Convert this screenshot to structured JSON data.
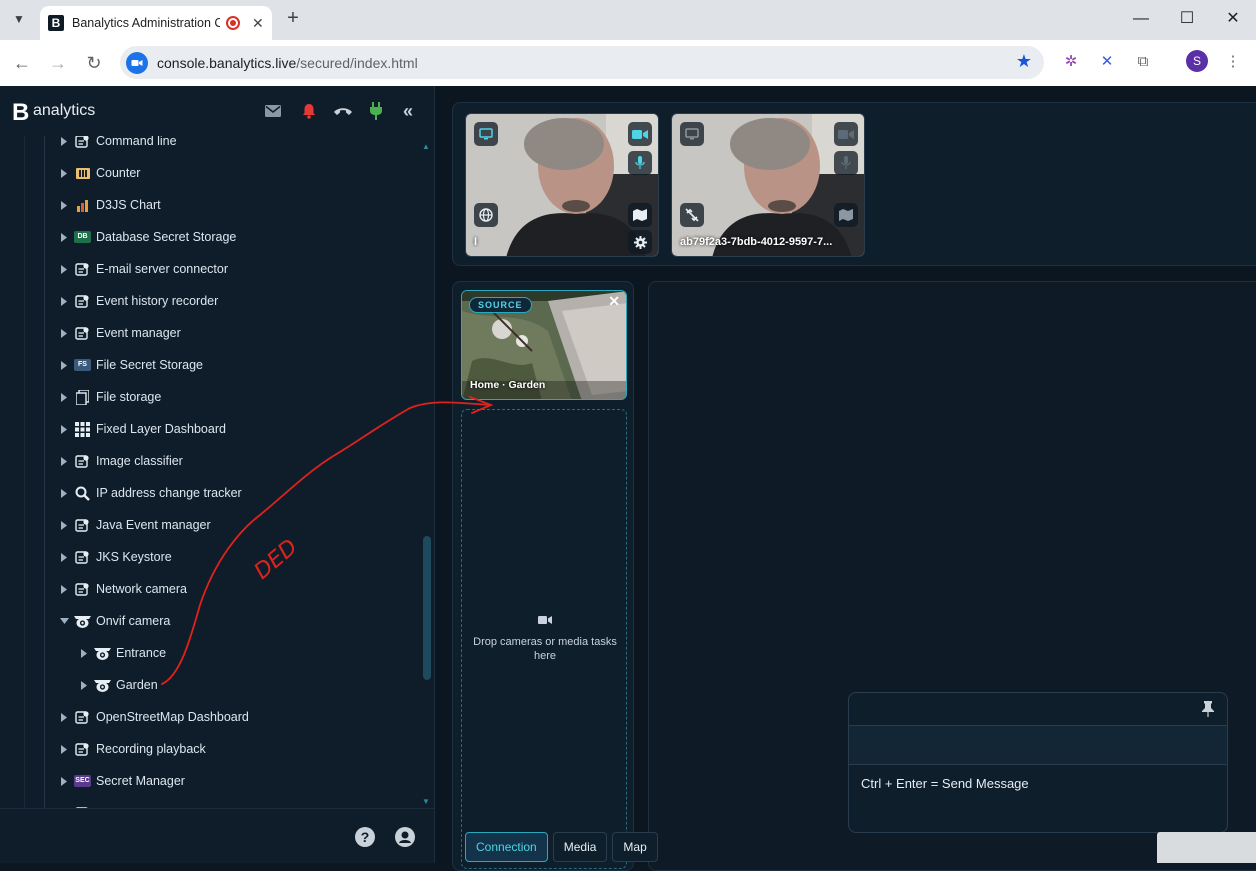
{
  "browser": {
    "tab_title": "Banalytics Administration C",
    "tab_favicon_letter": "B",
    "new_tab": "+",
    "url_host": "console.banalytics.live",
    "url_path": "/secured/index.html",
    "profile_initial": "S",
    "window_controls": [
      "minimize",
      "maximize",
      "close"
    ]
  },
  "app": {
    "logo_letter": "B",
    "logo_text": "analytics",
    "header_icons": [
      "mail-icon",
      "bell-icon",
      "phone-icon",
      "plug-icon",
      "collapse-icon"
    ],
    "tree": [
      {
        "label": "Command line",
        "icon": "command-icon",
        "expanded": false,
        "level": 1
      },
      {
        "label": "Counter",
        "icon": "counter-icon",
        "expanded": false,
        "level": 1
      },
      {
        "label": "D3JS Chart",
        "icon": "chart-icon",
        "expanded": false,
        "level": 1
      },
      {
        "label": "Database Secret Storage",
        "icon": "db-icon",
        "expanded": false,
        "level": 1
      },
      {
        "label": "E-mail server connector",
        "icon": "email-server-icon",
        "expanded": false,
        "level": 1
      },
      {
        "label": "Event history recorder",
        "icon": "recorder-icon",
        "expanded": false,
        "level": 1
      },
      {
        "label": "Event manager",
        "icon": "event-icon",
        "expanded": false,
        "level": 1
      },
      {
        "label": "File Secret Storage",
        "icon": "fs-icon",
        "expanded": false,
        "level": 1
      },
      {
        "label": "File storage",
        "icon": "file-storage-icon",
        "expanded": false,
        "level": 1
      },
      {
        "label": "Fixed Layer Dashboard",
        "icon": "grid-icon",
        "expanded": false,
        "level": 1
      },
      {
        "label": "Image classifier",
        "icon": "classifier-icon",
        "expanded": false,
        "level": 1
      },
      {
        "label": "IP address change tracker",
        "icon": "magnifier-icon",
        "expanded": false,
        "level": 1
      },
      {
        "label": "Java Event manager",
        "icon": "java-icon",
        "expanded": false,
        "level": 1
      },
      {
        "label": "JKS Keystore",
        "icon": "keystore-icon",
        "expanded": false,
        "level": 1
      },
      {
        "label": "Network camera",
        "icon": "network-camera-icon",
        "expanded": false,
        "level": 1
      },
      {
        "label": "Onvif camera",
        "icon": "onvif-camera-icon",
        "expanded": true,
        "level": 1
      },
      {
        "label": "Entrance",
        "icon": "onvif-camera-icon",
        "expanded": false,
        "level": 2
      },
      {
        "label": "Garden",
        "icon": "onvif-camera-icon",
        "expanded": false,
        "level": 2
      },
      {
        "label": "OpenStreetMap Dashboard",
        "icon": "map-dashboard-icon",
        "expanded": false,
        "level": 1
      },
      {
        "label": "Recording playback",
        "icon": "playback-icon",
        "expanded": false,
        "level": 1
      },
      {
        "label": "Secret Manager",
        "icon": "sec-icon",
        "expanded": false,
        "level": 1
      },
      {
        "label": "",
        "icon": "server-icon",
        "expanded": false,
        "level": 1
      }
    ],
    "badges": {
      "db": "DB",
      "fs": "FS",
      "sec": "SEC"
    },
    "footer": {
      "help": "?",
      "user": "user"
    },
    "video_tiles": [
      {
        "name": "I"
      },
      {
        "name": "ab79f2a3-7bdb-4012-9597-7..."
      }
    ],
    "source": {
      "badge": "SOURCE",
      "close": "✕",
      "name": "Home · Garden"
    },
    "drop_zone_text": "Drop cameras or media tasks here",
    "bottom_tabs": [
      "Connection",
      "Media",
      "Map"
    ],
    "active_tab": "Connection",
    "chat": {
      "hint": "Ctrl + Enter = Send Message"
    },
    "annotation_text": "DED",
    "colors": {
      "accent": "#2aa9bd",
      "arrow": "#e0221c",
      "bell": "#e53935",
      "plug": "#4caf50"
    }
  }
}
